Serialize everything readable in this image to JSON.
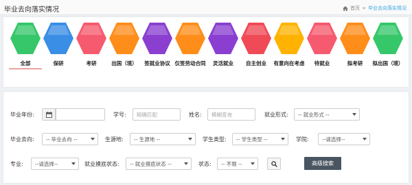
{
  "header": {
    "title": "毕业去向落实情况"
  },
  "breadcrumb": {
    "home": "首页",
    "separator": ">",
    "current": "毕业去向落实情况"
  },
  "tabs": [
    {
      "label": "全部",
      "color": "#35c769",
      "active": true
    },
    {
      "label": "保研",
      "color": "#3a8ee6"
    },
    {
      "label": "考研",
      "color": "#f65a6e"
    },
    {
      "label": "出国（境）",
      "color": "#ff8d1a"
    },
    {
      "label": "签就业协议",
      "color": "#8a3fd1"
    },
    {
      "label": "仅签劳动合同",
      "color": "#ff8d1a"
    },
    {
      "label": "灵活就业",
      "color": "#8a3fd1"
    },
    {
      "label": "自主创业",
      "color": "#f04a56"
    },
    {
      "label": "有意向在考虑",
      "color": "#ffb300"
    },
    {
      "label": "待就业",
      "color": "#f65a6e"
    },
    {
      "label": "拟考研",
      "color": "#ff8d1a"
    },
    {
      "label": "拟出国（境）",
      "color": "#35c769"
    }
  ],
  "filters": {
    "year_label": "毕业年份:",
    "year_value": "",
    "student_no_label": "学号:",
    "student_no_placeholder": "精确匹配",
    "name_label": "姓名:",
    "name_placeholder": "模糊查询",
    "employment_form_label": "就业形式:",
    "employment_form_value": "-- 就业形式 --",
    "destination_label": "毕业去向:",
    "destination_value": "-- 毕业去向 --",
    "origin_label": "生源地:",
    "origin_value": "-- 生源地 --",
    "student_type_label": "学生类型:",
    "student_type_value": "-- 学生类型 --",
    "college_label": "学院:",
    "college_value": "--请选择--",
    "major_label": "专业:",
    "major_value": "--请选择--",
    "survey_status_label": "就业摸底状态:",
    "survey_status_value": "-- 就业摸底状态 --",
    "status_label": "状态:",
    "status_value": "-- 不限 --",
    "advanced_search_label": "高级搜索"
  }
}
